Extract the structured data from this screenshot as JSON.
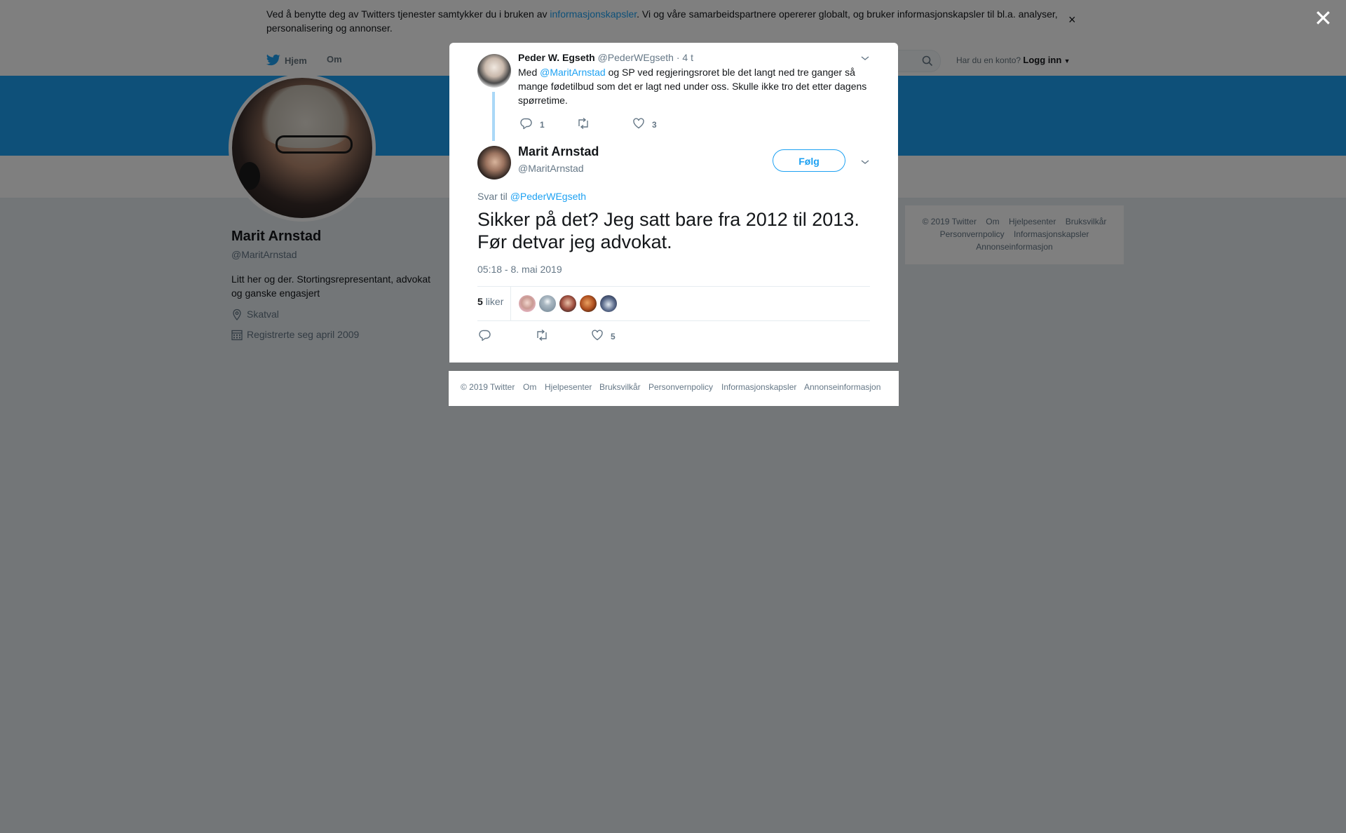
{
  "cookie_bar": {
    "text_before": "Ved å benytte deg av Twitters tjenester samtykker du i bruken av ",
    "link": "informasjonskapsler",
    "text_after": ". Vi og våre samarbeidspartnere opererer globalt, og bruker informasjonskapsler til bl.a. analyser, personalisering og annonser.",
    "close": "×"
  },
  "topnav": {
    "home": "Hjem",
    "about": "Om",
    "account_question": "Har du en konto?",
    "login": "Logg inn"
  },
  "profile": {
    "name": "Marit Arnstad",
    "handle": "@MaritArnstad",
    "bio": "Litt her og der. Stortingsrepresentant, advokat og ganske engasjert",
    "location": "Skatval",
    "joined": "Registrerte seg april 2009"
  },
  "side_footer": {
    "line1": [
      "© 2019 Twitter",
      "Om",
      "Hjelpesenter",
      "Bruksvilkår"
    ],
    "line2": [
      "Personvernpolicy",
      "Informasjonskapsler"
    ],
    "line3": [
      "Annonseinformasjon"
    ]
  },
  "overlay": {
    "close": "✕"
  },
  "parent_tweet": {
    "name": "Peder W. Egseth",
    "handle": "@PederWEgseth",
    "time": "· 4 t",
    "text_before": "Med ",
    "mention": "@MaritArnstad",
    "text_after": " og SP ved regjeringsroret ble det langt ned tre ganger så mange fødetilbud som det er lagt ned under oss. Skulle ikke tro det etter dagens spørretime.",
    "replies": "1",
    "retweets": "",
    "likes": "3"
  },
  "main_tweet": {
    "name": "Marit Arnstad",
    "handle": "@MaritArnstad",
    "follow": "Følg",
    "reply_to_label": "Svar til",
    "reply_to_handle": "@PederWEgseth",
    "text": "Sikker på det? Jeg satt bare fra 2012 til 2013. Før detvar jeg advokat.",
    "timestamp": "05:18 - 8. mai 2019",
    "likes_count": "5",
    "likes_label": "liker",
    "action_replies": "",
    "action_retweets": "",
    "action_likes": "5"
  },
  "modal_footer": [
    "© 2019 Twitter",
    "Om",
    "Hjelpesenter",
    "Bruksvilkår",
    "Personvernpolicy",
    "Informasjonskapsler",
    "Annonseinformasjon"
  ],
  "colors": {
    "accent": "#1da1f2",
    "overlay": "#00000080",
    "text": "#14171a",
    "muted": "#657786"
  }
}
